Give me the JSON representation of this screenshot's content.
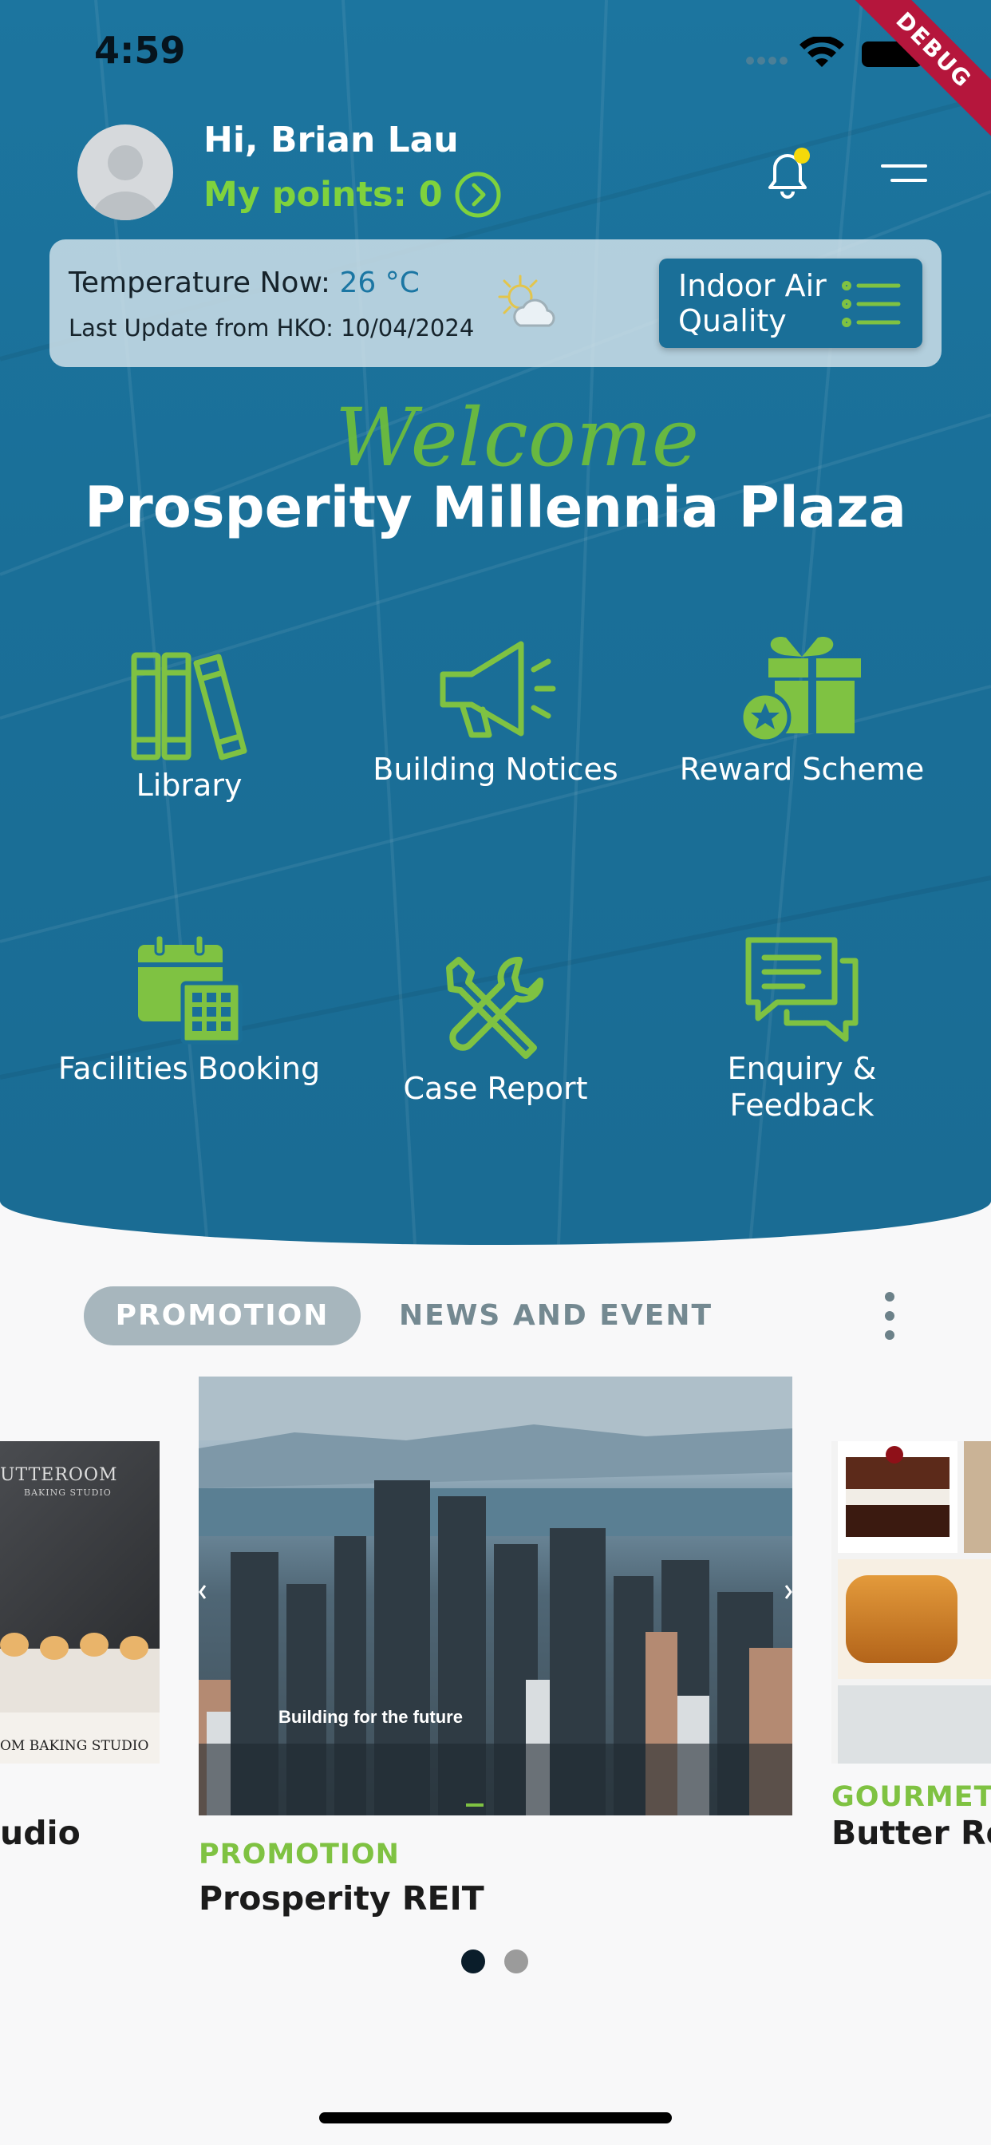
{
  "status_bar": {
    "time": "4:59"
  },
  "debug_banner": "DEBUG",
  "header": {
    "greeting": "Hi, Brian Lau",
    "points": "My points: 0"
  },
  "weather": {
    "temp_label": "Temperature Now:",
    "temp_value": "26 °C",
    "last_update": "Last Update from HKO: 10/04/2024",
    "indoor_air_quality_label": "Indoor Air Quality"
  },
  "welcome": {
    "script_text": "Welcome",
    "plaza_name": "Prosperity Millennia Plaza"
  },
  "services": [
    {
      "label": "Library",
      "icon": "library-icon"
    },
    {
      "label": "Building Notices",
      "icon": "megaphone-icon"
    },
    {
      "label": "Reward Scheme",
      "icon": "gift-icon"
    },
    {
      "label": "Facilities Booking",
      "icon": "calendar-icon"
    },
    {
      "label": "Case Report",
      "icon": "tools-icon"
    },
    {
      "label": "Enquiry & Feedback",
      "icon": "chat-icon"
    }
  ],
  "tabs": [
    {
      "label": "PROMOTION",
      "selected": true
    },
    {
      "label": "NEWS AND EVENT",
      "selected": false
    }
  ],
  "carousel": {
    "left_card": {
      "title": "udio",
      "image_text_top": "UTTEROOM",
      "image_text_sub": "BAKING STUDIO",
      "image_text_bottom": "OM BAKING STUDIO"
    },
    "center_card": {
      "category": "PROMOTION",
      "title": "Prosperity REIT",
      "image_caption": "Building for the future"
    },
    "right_card": {
      "category": "GOURMET",
      "title": "Butter Roo"
    },
    "page_count": 2,
    "active_page": 0
  },
  "colors": {
    "hero_blue": "#1a6f98",
    "accent_green": "#7fc242",
    "points_green": "#7fd23d",
    "notification_dot": "#f5d90a"
  }
}
